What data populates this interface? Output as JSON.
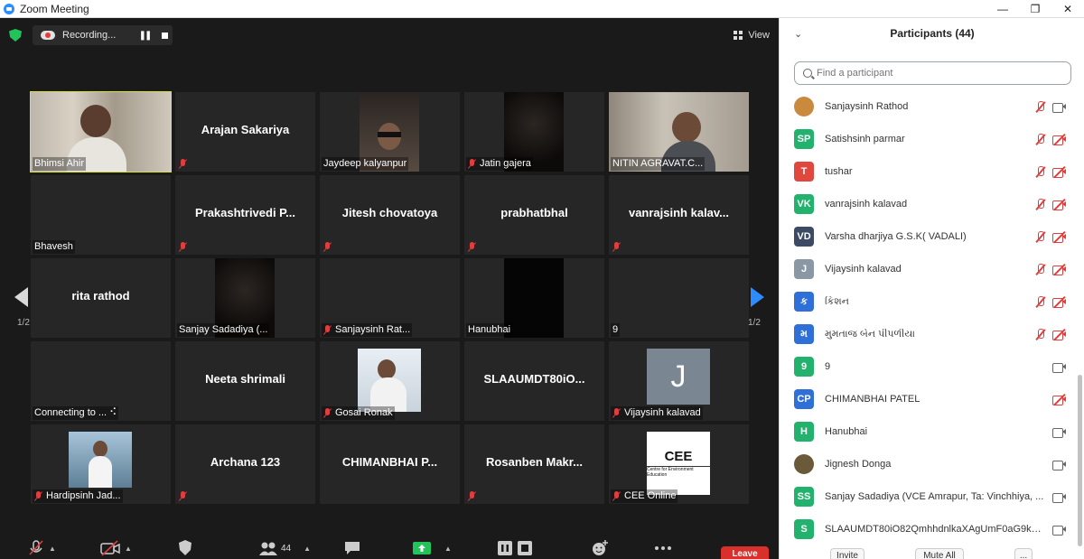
{
  "window": {
    "title": "Zoom Meeting",
    "controls": [
      "—",
      "❐",
      "✕"
    ]
  },
  "meeting": {
    "recording_label": "Recording...",
    "view_label": "View",
    "page_indicator": "1/2",
    "tiles": [
      {
        "name": "Bhimsi Ahir",
        "show_big": false,
        "muted": false,
        "video": "bhimsi",
        "active": true
      },
      {
        "name": "Arajan Sakariya",
        "show_big": true,
        "muted": true,
        "label": ""
      },
      {
        "name": "Jaydeep kalyanpur",
        "show_big": false,
        "muted": false,
        "video": "jaydeep"
      },
      {
        "name": "Jatin gajera",
        "show_big": false,
        "muted": true,
        "video": "dark"
      },
      {
        "name": "NITIN AGRAVAT.C...",
        "show_big": false,
        "muted": false,
        "video": "nitin"
      },
      {
        "name": "Bhavesh",
        "show_big": false,
        "muted": false
      },
      {
        "name": "Prakashtrivedi  P...",
        "show_big": true,
        "muted": true
      },
      {
        "name": "Jitesh chovatoya",
        "show_big": true,
        "muted": true
      },
      {
        "name": "prabhatbhal",
        "show_big": true,
        "muted": true
      },
      {
        "name": "vanrajsinh  kalav...",
        "show_big": true,
        "muted": true
      },
      {
        "name": "rita rathod",
        "show_big": true,
        "muted": false
      },
      {
        "name": "Sanjay Sadadiya (...",
        "show_big": false,
        "muted": false,
        "video": "dark"
      },
      {
        "name": "Sanjaysinh Rat...",
        "show_big": false,
        "muted": true
      },
      {
        "name": "Hanubhai",
        "show_big": false,
        "muted": false,
        "video": "black"
      },
      {
        "name": "9",
        "show_big": false,
        "muted": false
      },
      {
        "name": "Connecting to ... ⠪",
        "show_big": false,
        "muted": false
      },
      {
        "name": "Neeta shrimali",
        "show_big": true,
        "muted": false
      },
      {
        "name": "Gosai Ronak",
        "show_big": false,
        "muted": true,
        "video": "ronak"
      },
      {
        "name": "SLAAUMDT80iO...",
        "show_big": true,
        "muted": false
      },
      {
        "name": "Vijaysinh kalavad",
        "show_big": false,
        "muted": true,
        "video": "J"
      },
      {
        "name": "Hardipsinh Jad...",
        "show_big": false,
        "muted": true,
        "video": "hardip"
      },
      {
        "name": "Archana 123",
        "show_big": true,
        "muted": true
      },
      {
        "name": "CHIMANBHAI  P...",
        "show_big": true,
        "muted": false
      },
      {
        "name": "Rosanben  Makr...",
        "show_big": true,
        "muted": true
      },
      {
        "name": "CEE Online",
        "show_big": false,
        "muted": true,
        "video": "CEE"
      }
    ],
    "cee_logo": {
      "title": "CEE",
      "subtitle": "Centre for Environment Education"
    },
    "j_initial": "J",
    "participants_count": "44",
    "leave_label": "Leave"
  },
  "panel": {
    "title": "Participants (44)",
    "search_placeholder": "Find a participant",
    "participants": [
      {
        "initials": "",
        "name": "Sanjaysinh Rathod",
        "color": "#c98a3e",
        "mic_muted": true,
        "cam": "on",
        "photo": true
      },
      {
        "initials": "SP",
        "name": "Satishsinh parmar",
        "color": "#23b26d",
        "mic_muted": true,
        "cam": "off"
      },
      {
        "initials": "T",
        "name": "tushar",
        "color": "#e0483e",
        "mic_muted": true,
        "cam": "off"
      },
      {
        "initials": "VK",
        "name": "vanrajsinh kalavad",
        "color": "#23b26d",
        "mic_muted": true,
        "cam": "off"
      },
      {
        "initials": "VD",
        "name": "Varsha dharjiya G.S.K( VADALI)",
        "color": "#3c4a66",
        "mic_muted": true,
        "cam": "off"
      },
      {
        "initials": "J",
        "name": "Vijaysinh kalavad",
        "color": "#8a97a4",
        "mic_muted": true,
        "cam": "off"
      },
      {
        "initials": "ક",
        "name": "કિશન",
        "color": "#2e6fd8",
        "mic_muted": true,
        "cam": "off"
      },
      {
        "initials": "મ",
        "name": "મુમતાજ બેન પીપળીયા",
        "color": "#2e6fd8",
        "mic_muted": true,
        "cam": "off"
      },
      {
        "initials": "9",
        "name": "9",
        "color": "#23b26d",
        "mic_muted": false,
        "cam": "on"
      },
      {
        "initials": "CP",
        "name": "CHIMANBHAI PATEL",
        "color": "#2e6fd8",
        "mic_muted": false,
        "cam": "off"
      },
      {
        "initials": "H",
        "name": "Hanubhai",
        "color": "#23b26d",
        "mic_muted": false,
        "cam": "on"
      },
      {
        "initials": "",
        "name": "Jignesh Donga",
        "color": "#6b5a3a",
        "mic_muted": false,
        "cam": "on",
        "photo": true
      },
      {
        "initials": "SS",
        "name": "Sanjay Sadadiya (VCE Amrapur, Ta: Vinchhiya, ...",
        "color": "#23b26d",
        "mic_muted": false,
        "cam": "on"
      },
      {
        "initials": "S",
        "name": "SLAAUMDT80iO82QmhhdnlkaXAgUmF0aG9kQB...",
        "color": "#23b26d",
        "mic_muted": false,
        "cam": "on"
      }
    ],
    "buttons": {
      "invite": "Invite",
      "mute_all": "Mute All",
      "more": "..."
    }
  }
}
